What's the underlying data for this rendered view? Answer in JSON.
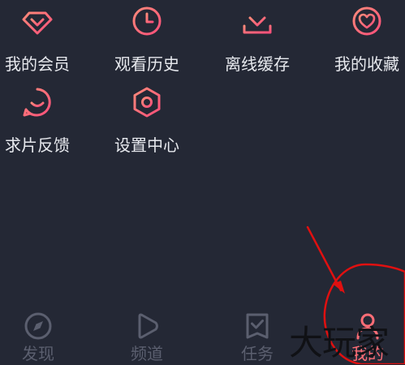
{
  "grid": {
    "items": [
      {
        "label": "我的会员",
        "icon": "diamond-icon"
      },
      {
        "label": "观看历史",
        "icon": "clock-icon"
      },
      {
        "label": "离线缓存",
        "icon": "download-icon"
      },
      {
        "label": "我的收藏",
        "icon": "heart-icon"
      },
      {
        "label": "求片反馈",
        "icon": "feedback-smile-icon"
      },
      {
        "label": "设置中心",
        "icon": "settings-hex-icon"
      }
    ]
  },
  "tabbar": {
    "tabs": [
      {
        "label": "发现",
        "icon": "compass-icon",
        "active": false
      },
      {
        "label": "频道",
        "icon": "play-icon",
        "active": false
      },
      {
        "label": "任务",
        "icon": "task-icon",
        "active": false
      },
      {
        "label": "我的",
        "icon": "user-icon",
        "active": true
      }
    ]
  },
  "overlay": {
    "watermark_text": "大玩家"
  },
  "colors": {
    "background": "#242835",
    "accent": "#ff6d76",
    "text": "#e7e9ee",
    "tab_inactive": "#5b5f6f",
    "annotation_red": "#e01010"
  }
}
